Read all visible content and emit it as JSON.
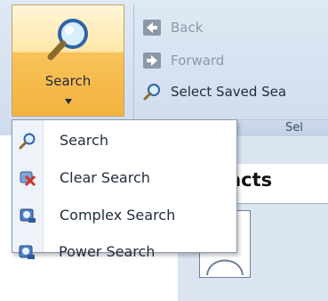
{
  "search_button": {
    "label": "Search",
    "icon": "magnifier-icon"
  },
  "ribbon_commands": [
    {
      "label": "Back",
      "icon": "back-arrow-icon",
      "state": "disabled"
    },
    {
      "label": "Forward",
      "icon": "forward-arrow-icon",
      "state": "disabled"
    },
    {
      "label": "Select Saved Sea",
      "icon": "magnifier-icon",
      "state": "enabled"
    }
  ],
  "ribbon_group_label": "Sel",
  "search_menu": {
    "items": [
      {
        "label": "Search",
        "icon": "magnifier-icon"
      },
      {
        "label": "Clear Search",
        "icon": "clear-search-icon"
      },
      {
        "label": "Complex Search",
        "icon": "complex-search-icon"
      },
      {
        "label": "Power Search",
        "icon": "power-search-icon"
      }
    ]
  },
  "contacts_panel": {
    "title": "ntacts"
  },
  "colors": {
    "ribbon_bg": "#dfe9f5",
    "button_highlight": "#f4b23e",
    "menu_border": "#8a99ad",
    "text": "#1e2b3d",
    "disabled_text": "#8d98a6"
  }
}
